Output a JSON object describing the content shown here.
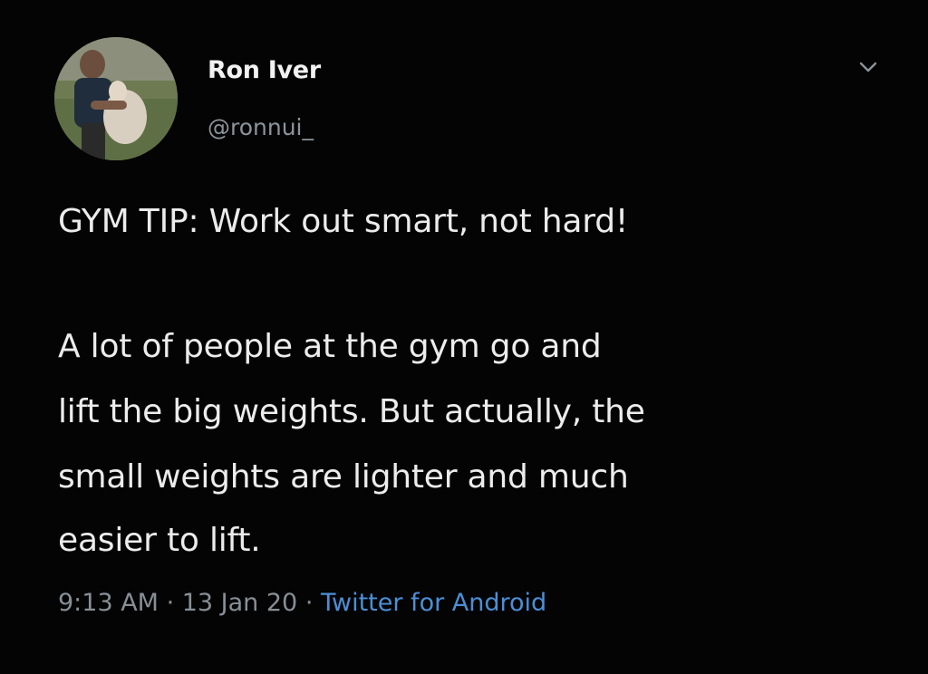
{
  "tweet": {
    "author": {
      "name": "Ron Iver",
      "handle": "@ronnui_"
    },
    "icons": {
      "avatar": "profile-photo",
      "menu": "chevron-down-icon"
    },
    "headline": "GYM TIP: Work out smart, not hard!",
    "body_lines": [
      "A lot of people at the gym go and",
      "lift the big weights. But actually, the",
      "small weights are lighter and much",
      "easier to lift."
    ],
    "meta": {
      "time": "9:13 AM",
      "separator": " · ",
      "date": "13 Jan 20",
      "source": "Twitter for Android"
    },
    "colors": {
      "background": "#040404",
      "text": "#ececec",
      "muted": "#878f96",
      "link": "#4c8fd6"
    }
  }
}
